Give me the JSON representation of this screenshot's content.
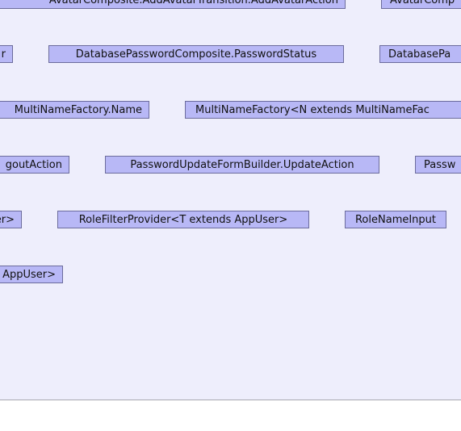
{
  "colors": {
    "background": "#eeeefc",
    "node_fill": "#b8b8f6",
    "node_border": "#6c6c9c",
    "text": "#111111"
  },
  "nodes": [
    {
      "label": "AvatarComposite.AddAvatarTransition.AddAvatarAction"
    },
    {
      "label": "AvatarComp"
    },
    {
      "label": "r"
    },
    {
      "label": "DatabasePasswordComposite.PasswordStatus"
    },
    {
      "label": "DatabasePa"
    },
    {
      "label": "MultiNameFactory.Name"
    },
    {
      "label": "MultiNameFactory<N extends MultiNameFac"
    },
    {
      "label": "goutAction"
    },
    {
      "label": "PasswordUpdateFormBuilder.UpdateAction"
    },
    {
      "label": "Passw"
    },
    {
      "label": "er>"
    },
    {
      "label": "RoleFilterProvider<T extends AppUser>"
    },
    {
      "label": "RoleNameInput"
    },
    {
      "label": "AppUser>"
    }
  ]
}
